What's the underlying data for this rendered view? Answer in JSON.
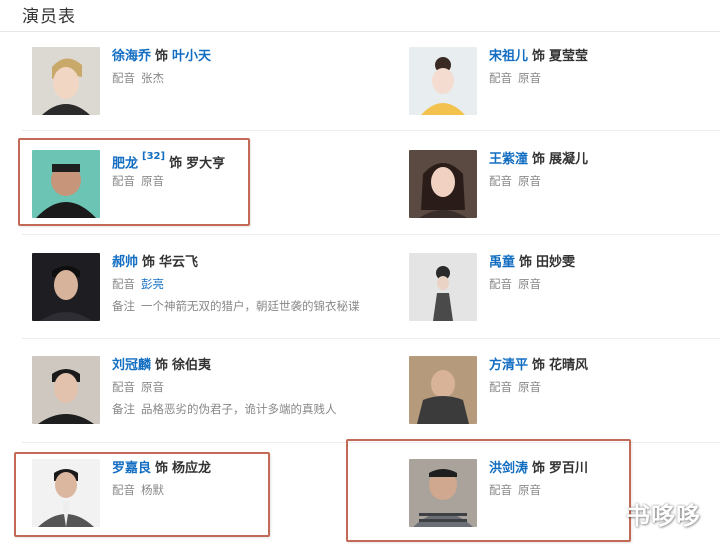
{
  "section_title": "演员表",
  "labels": {
    "dubbing": "配音",
    "note": "备注",
    "plays": "饰"
  },
  "cast": [
    {
      "actor": "徐海乔",
      "role": "叶小天",
      "role_is_link": true,
      "dubbing": "张杰",
      "dubbing_is_link": false,
      "note": ""
    },
    {
      "actor": "宋祖儿",
      "role": "夏莹莹",
      "role_is_link": false,
      "dubbing": "原音",
      "dubbing_is_link": false,
      "note": ""
    },
    {
      "actor": "肥龙",
      "ref": "[32]",
      "role": "罗大亨",
      "role_is_link": false,
      "dubbing": "原音",
      "dubbing_is_link": false,
      "note": ""
    },
    {
      "actor": "王紫潼",
      "role": "展凝儿",
      "role_is_link": false,
      "dubbing": "原音",
      "dubbing_is_link": false,
      "note": ""
    },
    {
      "actor": "郝帅",
      "role": "华云飞",
      "role_is_link": false,
      "dubbing": "彭亮",
      "dubbing_is_link": true,
      "note": "一个神箭无双的猎户，朝廷世袭的锦衣秘谍"
    },
    {
      "actor": "禹童",
      "role": "田妙雯",
      "role_is_link": false,
      "dubbing": "原音",
      "dubbing_is_link": false,
      "note": ""
    },
    {
      "actor": "刘冠麟",
      "role": "徐伯夷",
      "role_is_link": false,
      "dubbing": "原音",
      "dubbing_is_link": false,
      "note": "品格恶劣的伪君子，诡计多端的真贱人"
    },
    {
      "actor": "方清平",
      "role": "花晴风",
      "role_is_link": false,
      "dubbing": "原音",
      "dubbing_is_link": false,
      "note": ""
    },
    {
      "actor": "罗嘉良",
      "role": "杨应龙",
      "role_is_link": false,
      "dubbing": "杨默",
      "dubbing_is_link": false,
      "note": ""
    },
    {
      "actor": "洪剑涛",
      "role": "罗百川",
      "role_is_link": false,
      "dubbing": "原音",
      "dubbing_is_link": false,
      "note": ""
    }
  ],
  "watermark": "书哆哆",
  "colors": {
    "link": "#136ec2",
    "highlight_box": "#c26a55",
    "muted": "#888888"
  }
}
